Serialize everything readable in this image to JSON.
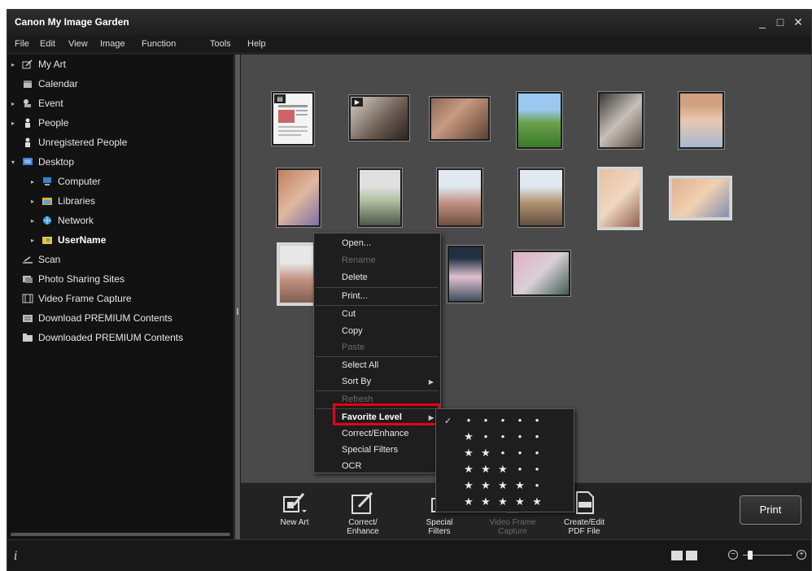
{
  "window": {
    "title": "Canon My Image Garden",
    "controls": {
      "minimize": "_",
      "maximize": "□",
      "close": "✕"
    }
  },
  "menubar": [
    "File",
    "Edit",
    "View",
    "Image",
    "Function",
    "Tools",
    "Help"
  ],
  "sidebar": {
    "items": [
      {
        "label": "My Art",
        "icon": "my-art-icon",
        "arrow": "▸"
      },
      {
        "label": "Calendar",
        "icon": "calendar-icon",
        "arrow": ""
      },
      {
        "label": "Event",
        "icon": "event-icon",
        "arrow": "▸"
      },
      {
        "label": "People",
        "icon": "people-icon",
        "arrow": "▸"
      },
      {
        "label": "Unregistered People",
        "icon": "unregistered-people-icon",
        "arrow": ""
      },
      {
        "label": "Desktop",
        "icon": "desktop-icon",
        "arrow": "▾"
      },
      {
        "label": "Computer",
        "icon": "computer-icon",
        "arrow": "▸"
      },
      {
        "label": "Libraries",
        "icon": "libraries-icon",
        "arrow": "▸"
      },
      {
        "label": "Network",
        "icon": "network-icon",
        "arrow": "▸"
      },
      {
        "label": "UserName",
        "icon": "user-folder-icon",
        "arrow": "▸"
      },
      {
        "label": "Scan",
        "icon": "scan-icon",
        "arrow": ""
      },
      {
        "label": "Photo Sharing Sites",
        "icon": "photo-sharing-icon",
        "arrow": ""
      },
      {
        "label": "Video Frame Capture",
        "icon": "video-frame-icon",
        "arrow": ""
      },
      {
        "label": "Download PREMIUM Contents",
        "icon": "download-premium-icon",
        "arrow": ""
      },
      {
        "label": "Downloaded PREMIUM Contents",
        "icon": "downloaded-premium-icon",
        "arrow": ""
      }
    ]
  },
  "context_menu": {
    "items": [
      "Open...",
      "Rename",
      "Delete",
      "Print...",
      "Cut",
      "Copy",
      "Paste",
      "Select All",
      "Sort By",
      "Refresh",
      "Favorite Level",
      "Correct/Enhance",
      "Special Filters",
      "OCR"
    ]
  },
  "favorite_submenu": {
    "check_mark": "✓",
    "star": "★",
    "dot": "•",
    "levels": [
      0,
      1,
      2,
      3,
      4,
      5
    ],
    "selected_level": 0
  },
  "toolbar": {
    "buttons": [
      {
        "line1": "New Art",
        "line2": ""
      },
      {
        "line1": "Correct/",
        "line2": "Enhance"
      },
      {
        "line1": "Special",
        "line2": "Filters"
      },
      {
        "line1": "Video Frame",
        "line2": "Capture"
      },
      {
        "line1": "Create/Edit",
        "line2": "PDF File"
      }
    ],
    "print_label": "Print"
  },
  "statusbar": {
    "info": "i",
    "zoom_minus": "−",
    "zoom_plus": "+",
    "zoom_level": 0.15
  },
  "colors": {
    "highlight": "#e60012",
    "background": "#1c1c1c",
    "content": "#4a4a4a"
  }
}
